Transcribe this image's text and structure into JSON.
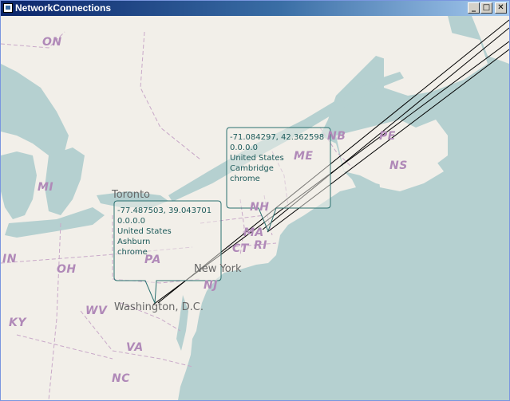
{
  "window": {
    "title": "NetworkConnections",
    "buttons": {
      "minimize": "_",
      "maximize": "□",
      "close": "✕"
    }
  },
  "map": {
    "state_labels": [
      "ON",
      "MI",
      "IN",
      "OH",
      "KY",
      "WV",
      "VA",
      "NC",
      "PA",
      "NJ",
      "NH",
      "ME",
      "NB",
      "PE",
      "NS",
      "MA",
      "CT",
      "RI"
    ],
    "city_labels": [
      "Toronto",
      "New York",
      "Washington, D.C."
    ]
  },
  "connections": [
    {
      "coords": "-77.487503, 39.043701",
      "ip": "0.0.0.0",
      "country": "United States",
      "city": "Ashburn",
      "app": "chrome"
    },
    {
      "coords": "-71.084297, 42.362598",
      "ip": "0.0.0.0",
      "country": "United States",
      "city": "Cambridge",
      "app": "chrome"
    }
  ]
}
